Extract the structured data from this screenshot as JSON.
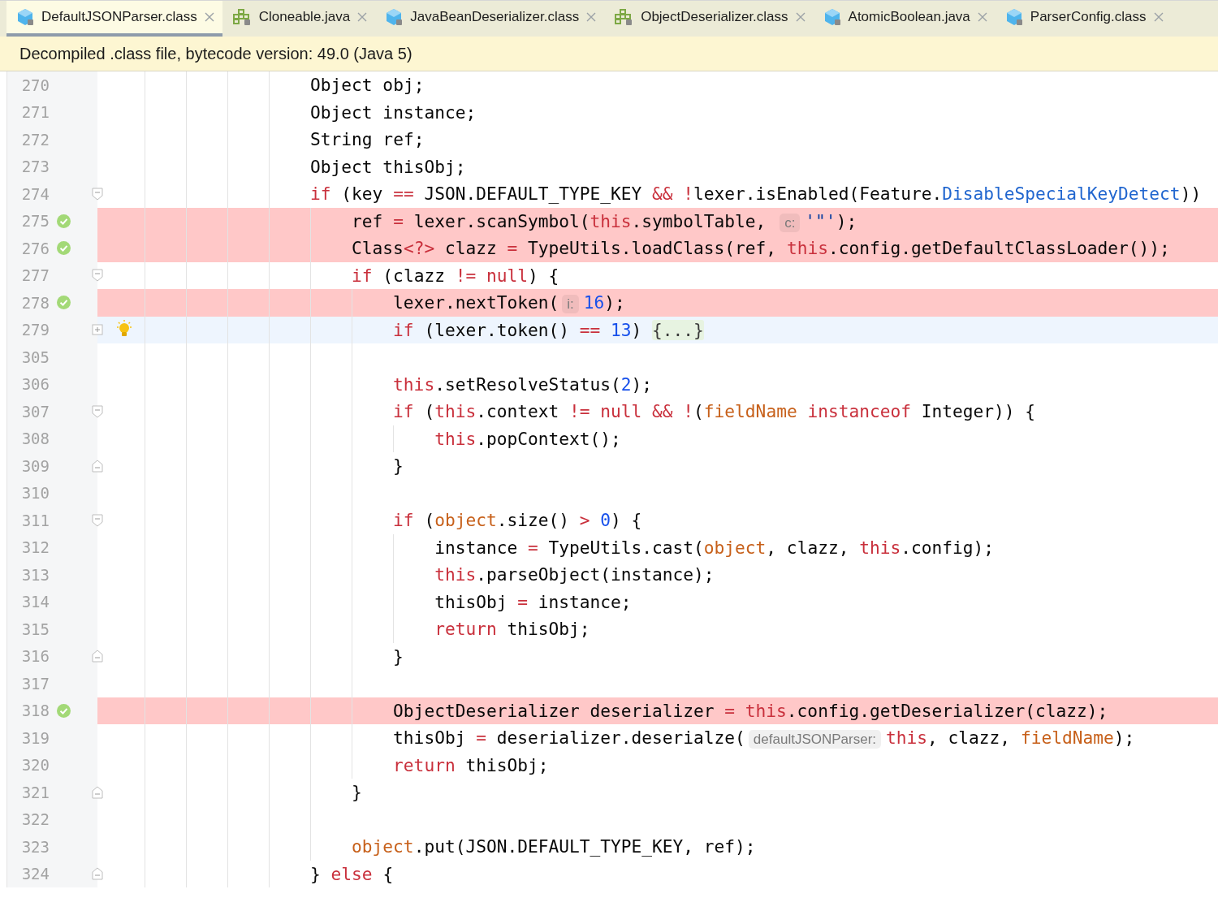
{
  "tabs": [
    {
      "label": "DefaultJSONParser.class",
      "kind": "class",
      "selected": true
    },
    {
      "label": "Cloneable.java",
      "kind": "interface",
      "selected": false
    },
    {
      "label": "JavaBeanDeserializer.class",
      "kind": "class",
      "selected": false
    },
    {
      "label": "ObjectDeserializer.class",
      "kind": "interface",
      "selected": false
    },
    {
      "label": "AtomicBoolean.java",
      "kind": "class",
      "selected": false
    },
    {
      "label": "ParserConfig.class",
      "kind": "class",
      "selected": false
    }
  ],
  "banner": "Decompiled .class file, bytecode version: 49.0 (Java 5)",
  "lines": [
    {
      "n": "270",
      "kind": "plain",
      "covered": false,
      "current": false,
      "intention": false,
      "tokens": [
        {
          "t": "                    Object obj;",
          "kind": "plain"
        }
      ]
    },
    {
      "n": "271",
      "kind": "plain",
      "covered": false,
      "current": false,
      "intention": false,
      "tokens": [
        {
          "t": "                    Object instance;",
          "kind": "plain"
        }
      ]
    },
    {
      "n": "272",
      "kind": "plain",
      "covered": false,
      "current": false,
      "intention": false,
      "tokens": [
        {
          "t": "                    String ref;",
          "kind": "plain"
        }
      ]
    },
    {
      "n": "273",
      "kind": "plain",
      "covered": false,
      "current": false,
      "intention": false,
      "tokens": [
        {
          "t": "                    Object thisObj;",
          "kind": "plain"
        }
      ]
    },
    {
      "n": "274",
      "kind": "fold-start",
      "covered": false,
      "current": false,
      "intention": false,
      "tokens": [
        {
          "t": "                    if",
          "kind": "keyword"
        },
        {
          "t": " (key ",
          "kind": "plain"
        },
        {
          "t": "==",
          "kind": "keyword"
        },
        {
          "t": " JSON.DEFAULT_TYPE_KEY ",
          "kind": "plain"
        },
        {
          "t": "&&",
          "kind": "keyword"
        },
        {
          "t": " !",
          "kind": "keyword"
        },
        {
          "t": "lexer.isEnabled(Feature.",
          "kind": "plain"
        },
        {
          "t": "DisableSpecialKeyDetect",
          "kind": "link"
        },
        {
          "t": "))",
          "kind": "plain"
        }
      ]
    },
    {
      "n": "275",
      "kind": "plain",
      "covered": true,
      "current": false,
      "intention": false,
      "tokens": [
        {
          "t": "                        ref ",
          "kind": "plain"
        },
        {
          "t": "=",
          "kind": "keyword"
        },
        {
          "t": " lexer.scanSymbol(",
          "kind": "plain"
        },
        {
          "t": "this",
          "kind": "keyword"
        },
        {
          "t": ".symbolTable, ",
          "kind": "plain"
        },
        {
          "t": "c:",
          "kind": "hint"
        },
        {
          "t": "'\"'",
          "kind": "string"
        },
        {
          "t": ");",
          "kind": "plain"
        }
      ]
    },
    {
      "n": "276",
      "kind": "plain",
      "covered": true,
      "current": false,
      "intention": false,
      "tokens": [
        {
          "t": "                        Class",
          "kind": "plain"
        },
        {
          "t": "<?>",
          "kind": "keyword"
        },
        {
          "t": " clazz ",
          "kind": "plain"
        },
        {
          "t": "=",
          "kind": "keyword"
        },
        {
          "t": " TypeUtils.loadClass(ref, ",
          "kind": "plain"
        },
        {
          "t": "this",
          "kind": "keyword"
        },
        {
          "t": ".config.getDefaultClassLoader());",
          "kind": "plain"
        }
      ]
    },
    {
      "n": "277",
      "kind": "fold-start",
      "covered": false,
      "current": false,
      "intention": false,
      "tokens": [
        {
          "t": "                        if",
          "kind": "keyword"
        },
        {
          "t": " (clazz ",
          "kind": "plain"
        },
        {
          "t": "!=",
          "kind": "keyword"
        },
        {
          "t": " null",
          "kind": "keyword"
        },
        {
          "t": ") {",
          "kind": "plain"
        }
      ]
    },
    {
      "n": "278",
      "kind": "plain",
      "covered": true,
      "current": false,
      "intention": false,
      "tokens": [
        {
          "t": "                            lexer.nextToken(",
          "kind": "plain"
        },
        {
          "t": "i:",
          "kind": "hint"
        },
        {
          "t": "16",
          "kind": "number"
        },
        {
          "t": ");",
          "kind": "plain"
        }
      ]
    },
    {
      "n": "279",
      "kind": "collapsed",
      "covered": false,
      "current": true,
      "intention": true,
      "tokens": [
        {
          "t": "                            if",
          "kind": "keyword"
        },
        {
          "t": " (lexer.token() ",
          "kind": "plain"
        },
        {
          "t": "==",
          "kind": "keyword"
        },
        {
          "t": " 13",
          "kind": "number"
        },
        {
          "t": ") ",
          "kind": "plain"
        },
        {
          "t": "{...}",
          "kind": "folded"
        }
      ]
    },
    {
      "n": "305",
      "kind": "plain",
      "covered": false,
      "current": false,
      "intention": false
    },
    {
      "n": "306",
      "kind": "plain",
      "covered": false,
      "current": false,
      "intention": false,
      "tokens": [
        {
          "t": "                            this",
          "kind": "keyword"
        },
        {
          "t": ".setResolveStatus(",
          "kind": "plain"
        },
        {
          "t": "2",
          "kind": "number"
        },
        {
          "t": ");",
          "kind": "plain"
        }
      ]
    },
    {
      "n": "307",
      "kind": "fold-start",
      "covered": false,
      "current": false,
      "intention": false,
      "tokens": [
        {
          "t": "                            if",
          "kind": "keyword"
        },
        {
          "t": " (",
          "kind": "plain"
        },
        {
          "t": "this",
          "kind": "keyword"
        },
        {
          "t": ".context ",
          "kind": "plain"
        },
        {
          "t": "!=",
          "kind": "keyword"
        },
        {
          "t": " null",
          "kind": "keyword"
        },
        {
          "t": " &&",
          "kind": "keyword"
        },
        {
          "t": " !",
          "kind": "keyword"
        },
        {
          "t": "(",
          "kind": "plain"
        },
        {
          "t": "fieldName",
          "kind": "field"
        },
        {
          "t": " instanceof",
          "kind": "keyword"
        },
        {
          "t": " Integer)) {",
          "kind": "plain"
        }
      ]
    },
    {
      "n": "308",
      "kind": "plain",
      "covered": false,
      "current": false,
      "intention": false,
      "tokens": [
        {
          "t": "                                this",
          "kind": "keyword"
        },
        {
          "t": ".popContext();",
          "kind": "plain"
        }
      ]
    },
    {
      "n": "309",
      "kind": "fold-end",
      "covered": false,
      "current": false,
      "intention": false,
      "tokens": [
        {
          "t": "                            }",
          "kind": "plain"
        }
      ]
    },
    {
      "n": "310",
      "kind": "plain",
      "covered": false,
      "current": false,
      "intention": false
    },
    {
      "n": "311",
      "kind": "fold-start",
      "covered": false,
      "current": false,
      "intention": false,
      "tokens": [
        {
          "t": "                            if",
          "kind": "keyword"
        },
        {
          "t": " (",
          "kind": "plain"
        },
        {
          "t": "object",
          "kind": "field"
        },
        {
          "t": ".size() ",
          "kind": "plain"
        },
        {
          "t": ">",
          "kind": "keyword"
        },
        {
          "t": " 0",
          "kind": "number"
        },
        {
          "t": ") {",
          "kind": "plain"
        }
      ]
    },
    {
      "n": "312",
      "kind": "plain",
      "covered": false,
      "current": false,
      "intention": false,
      "tokens": [
        {
          "t": "                                instance ",
          "kind": "plain"
        },
        {
          "t": "=",
          "kind": "keyword"
        },
        {
          "t": " TypeUtils.cast(",
          "kind": "plain"
        },
        {
          "t": "object",
          "kind": "field"
        },
        {
          "t": ", clazz, ",
          "kind": "plain"
        },
        {
          "t": "this",
          "kind": "keyword"
        },
        {
          "t": ".config);",
          "kind": "plain"
        }
      ]
    },
    {
      "n": "313",
      "kind": "plain",
      "covered": false,
      "current": false,
      "intention": false,
      "tokens": [
        {
          "t": "                                this",
          "kind": "keyword"
        },
        {
          "t": ".parseObject(instance);",
          "kind": "plain"
        }
      ]
    },
    {
      "n": "314",
      "kind": "plain",
      "covered": false,
      "current": false,
      "intention": false,
      "tokens": [
        {
          "t": "                                thisObj ",
          "kind": "plain"
        },
        {
          "t": "=",
          "kind": "keyword"
        },
        {
          "t": " instance;",
          "kind": "plain"
        }
      ]
    },
    {
      "n": "315",
      "kind": "plain",
      "covered": false,
      "current": false,
      "intention": false,
      "tokens": [
        {
          "t": "                                return",
          "kind": "keyword"
        },
        {
          "t": " thisObj;",
          "kind": "plain"
        }
      ]
    },
    {
      "n": "316",
      "kind": "fold-end",
      "covered": false,
      "current": false,
      "intention": false,
      "tokens": [
        {
          "t": "                            }",
          "kind": "plain"
        }
      ]
    },
    {
      "n": "317",
      "kind": "plain",
      "covered": false,
      "current": false,
      "intention": false
    },
    {
      "n": "318",
      "kind": "plain",
      "covered": true,
      "current": false,
      "intention": false,
      "tokens": [
        {
          "t": "                            ObjectDeserializer deserializer ",
          "kind": "plain"
        },
        {
          "t": "=",
          "kind": "keyword"
        },
        {
          "t": " this",
          "kind": "keyword"
        },
        {
          "t": ".config.getDeserializer(clazz);",
          "kind": "plain"
        }
      ]
    },
    {
      "n": "319",
      "kind": "plain",
      "covered": false,
      "current": false,
      "intention": false,
      "tokens": [
        {
          "t": "                            thisObj ",
          "kind": "plain"
        },
        {
          "t": "=",
          "kind": "keyword"
        },
        {
          "t": " deserializer.deserialze(",
          "kind": "plain"
        },
        {
          "t": "defaultJSONParser:",
          "kind": "hint"
        },
        {
          "t": "this",
          "kind": "keyword"
        },
        {
          "t": ", clazz, ",
          "kind": "plain"
        },
        {
          "t": "fieldName",
          "kind": "field"
        },
        {
          "t": ");",
          "kind": "plain"
        }
      ]
    },
    {
      "n": "320",
      "kind": "plain",
      "covered": false,
      "current": false,
      "intention": false,
      "tokens": [
        {
          "t": "                            return",
          "kind": "keyword"
        },
        {
          "t": " thisObj;",
          "kind": "plain"
        }
      ]
    },
    {
      "n": "321",
      "kind": "fold-end",
      "covered": false,
      "current": false,
      "intention": false,
      "tokens": [
        {
          "t": "                        }",
          "kind": "plain"
        }
      ]
    },
    {
      "n": "322",
      "kind": "plain",
      "covered": false,
      "current": false,
      "intention": false
    },
    {
      "n": "323",
      "kind": "plain",
      "covered": false,
      "current": false,
      "intention": false,
      "tokens": [
        {
          "t": "                        object",
          "kind": "field"
        },
        {
          "t": ".put(JSON.DEFAULT_TYPE_KEY, ref);",
          "kind": "plain"
        }
      ]
    },
    {
      "n": "324",
      "kind": "fold-end",
      "covered": false,
      "current": false,
      "intention": false,
      "tokens": [
        {
          "t": "                    } ",
          "kind": "plain"
        },
        {
          "t": "else",
          "kind": "keyword"
        },
        {
          "t": " {",
          "kind": "plain"
        }
      ]
    }
  ]
}
